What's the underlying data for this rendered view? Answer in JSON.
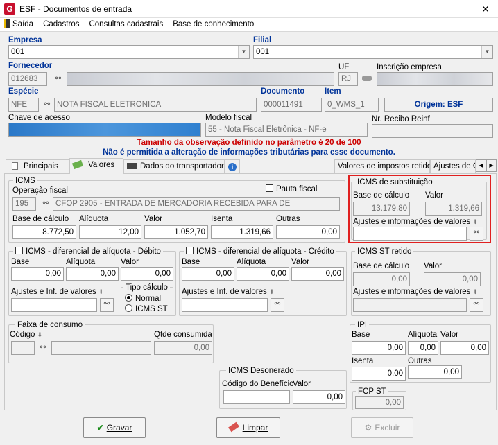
{
  "window": {
    "title": "ESF - Documentos de entrada",
    "close": "✕"
  },
  "menu": [
    "Saída",
    "Cadastros",
    "Consultas cadastrais",
    "Base de conhecimento"
  ],
  "header": {
    "empresa_label": "Empresa",
    "empresa_value": "001",
    "filial_label": "Filial",
    "filial_value": "001",
    "fornecedor_label": "Fornecedor",
    "fornecedor_value": "012683",
    "uf_label": "UF",
    "uf_value": "RJ",
    "inscricao_label": "Inscrição empresa",
    "especie_label": "Espécie",
    "especie_value": "NFE",
    "especie_desc": "NOTA FISCAL ELETRONICA",
    "documento_label": "Documento",
    "documento_value": "000011491",
    "item_label": "Item",
    "item_value": "0_WMS_1",
    "origem": "Origem: ESF",
    "chave_label": "Chave de acesso",
    "modelo_label": "Modelo fiscal",
    "modelo_value": "55 - Nota Fiscal Eletrônica - NF-e",
    "recibo_label": "Nr. Recibo Reinf",
    "warning1": "Tamanho da observação definido no parâmetro é 20 de 100",
    "warning2": "Não é permitida a alteração de informações tributárias para esse documento."
  },
  "tabs": [
    "Principais",
    "Valores",
    "Dados do transportador",
    "Valores de impostos retidos",
    "Ajustes de C"
  ],
  "icms": {
    "title": "ICMS",
    "operacao_label": "Operação fiscal",
    "operacao_code": "195",
    "operacao_desc": "CFOP 2905 - ENTRADA DE MERCADORIA RECEBIDA PARA DE",
    "pauta_label": "Pauta fiscal",
    "base_label": "Base de cálculo",
    "base_value": "8.772,50",
    "aliquota_label": "Alíquota",
    "aliquota_value": "12,00",
    "valor_label": "Valor",
    "valor_value": "1.052,70",
    "isenta_label": "Isenta",
    "isenta_value": "1.319,66",
    "outras_label": "Outras",
    "outras_value": "0,00"
  },
  "icms_st": {
    "title": "ICMS de substituição",
    "base_label": "Base de cálculo",
    "base_value": "13.179,80",
    "valor_label": "Valor",
    "valor_value": "1.319,66",
    "ajustes_label": "Ajustes e informações de valores"
  },
  "difal_debito": {
    "title": "ICMS - diferencial de alíquota - Débito",
    "base_label": "Base",
    "base_value": "0,00",
    "aliquota_label": "Alíquota",
    "aliquota_value": "0,00",
    "valor_label": "Valor",
    "valor_value": "0,00",
    "ajustes_label": "Ajustes e Inf. de valores",
    "tipo_label": "Tipo cálculo",
    "normal_label": "Normal",
    "icmsst_label": "ICMS ST"
  },
  "difal_credito": {
    "title": "ICMS - diferencial de alíquota - Crédito",
    "base_label": "Base",
    "base_value": "0,00",
    "aliquota_label": "Alíquota",
    "aliquota_value": "0,00",
    "valor_label": "Valor",
    "valor_value": "0,00",
    "ajustes_label": "Ajustes e Inf. de valores"
  },
  "st_retido": {
    "title": "ICMS ST retido",
    "base_label": "Base de cálculo",
    "base_value": "0,00",
    "valor_label": "Valor",
    "valor_value": "0,00",
    "ajustes_label": "Ajustes e informações de valores"
  },
  "faixa": {
    "title": "Faixa de consumo",
    "codigo_label": "Código",
    "qtde_label": "Qtde consumida",
    "qtde_value": "0,00"
  },
  "ipi": {
    "title": "IPI",
    "base_label": "Base",
    "base_value": "0,00",
    "aliquota_label": "Alíquota",
    "aliquota_value": "0,00",
    "valor_label": "Valor",
    "valor_value": "0,00",
    "isenta_label": "Isenta",
    "isenta_value": "0,00",
    "outras_label": "Outras",
    "outras_value": "0,00"
  },
  "desonerado": {
    "title": "ICMS Desonerado",
    "codigo_label": "Código do Benefício",
    "valor_label": "Valor",
    "valor_value": "0,00"
  },
  "fcp_st": {
    "title": "FCP ST",
    "value": "0,00"
  },
  "buttons": {
    "gravar": "Gravar",
    "limpar": "Limpar",
    "excluir": "Excluir"
  },
  "colors": {
    "highlight": "#e02020",
    "warning": "#cc0000",
    "label_blue": "#003399"
  }
}
